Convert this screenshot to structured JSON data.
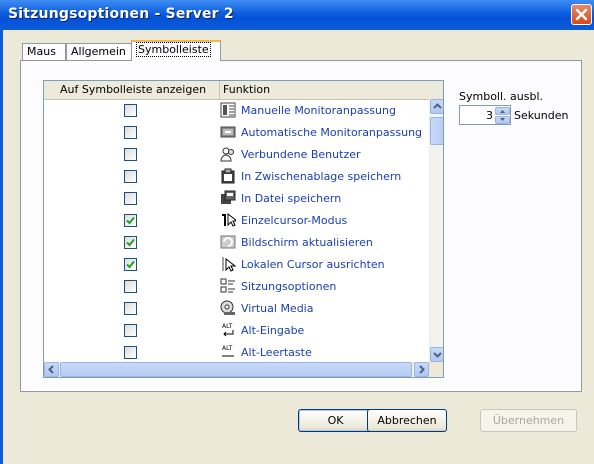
{
  "window": {
    "title": "Sitzungsoptionen - Server 2",
    "close_icon": "close-icon"
  },
  "tabs": [
    {
      "label": "Maus"
    },
    {
      "label": "Allgemein"
    },
    {
      "label": "Symbolleiste",
      "active": true
    }
  ],
  "list": {
    "headers": {
      "show": "Auf Symbolleiste anzeigen",
      "function": "Funktion"
    },
    "rows": [
      {
        "checked": false,
        "label": "Manuelle Monitoranpassung",
        "icon": "monitor-adjust-icon"
      },
      {
        "checked": false,
        "label": "Automatische Monitoranpassung",
        "icon": "auto-adjust-icon"
      },
      {
        "checked": false,
        "label": "Verbundene Benutzer",
        "icon": "users-icon"
      },
      {
        "checked": false,
        "label": "In Zwischenablage speichern",
        "icon": "clipboard-icon"
      },
      {
        "checked": false,
        "label": "In Datei speichern",
        "icon": "save-file-icon"
      },
      {
        "checked": true,
        "label": "Einzelcursor-Modus",
        "icon": "single-cursor-icon"
      },
      {
        "checked": true,
        "label": "Bildschirm aktualisieren",
        "icon": "refresh-screen-icon"
      },
      {
        "checked": true,
        "label": "Lokalen Cursor ausrichten",
        "icon": "align-cursor-icon"
      },
      {
        "checked": false,
        "label": "Sitzungsoptionen",
        "icon": "session-options-icon"
      },
      {
        "checked": false,
        "label": "Virtual Media",
        "icon": "virtual-media-icon"
      },
      {
        "checked": false,
        "label": "Alt-Eingabe",
        "icon": "alt-enter-icon"
      },
      {
        "checked": false,
        "label": "Alt-Leertaste",
        "icon": "alt-space-icon"
      }
    ]
  },
  "symbol_hide": {
    "label": "Symboll. ausbl.",
    "value": "3",
    "unit": "Sekunden"
  },
  "buttons": {
    "ok": "OK",
    "cancel": "Abbrechen",
    "apply": "Übernehmen"
  },
  "colors": {
    "titlebar": "#0a5cda",
    "checkmark": "#21a121",
    "link_text": "#1a3fb0"
  }
}
